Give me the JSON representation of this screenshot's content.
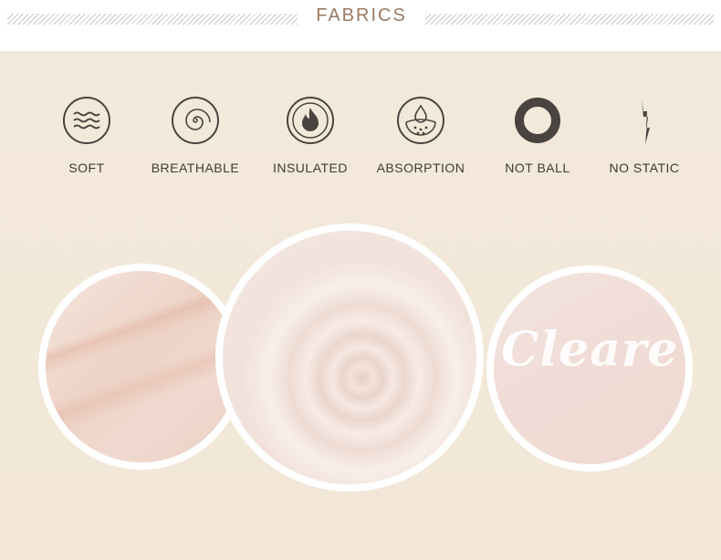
{
  "header": {
    "title": "FABRICS"
  },
  "features": [
    {
      "label": "SOFT",
      "icon": "waves-icon"
    },
    {
      "label": "BREATHABLE",
      "icon": "spiral-icon"
    },
    {
      "label": "INSULATED",
      "icon": "flame-icon"
    },
    {
      "label": "ABSORPTION",
      "icon": "droplet-icon"
    },
    {
      "label": "NOT BALL",
      "icon": "ring-icon"
    },
    {
      "label": "NO STATIC",
      "icon": "lightning-icon"
    }
  ],
  "images": {
    "print_text": "Cleare"
  },
  "colors": {
    "title": "#9a7b64",
    "background": "#f3e9da",
    "icon": "#4a4440"
  }
}
